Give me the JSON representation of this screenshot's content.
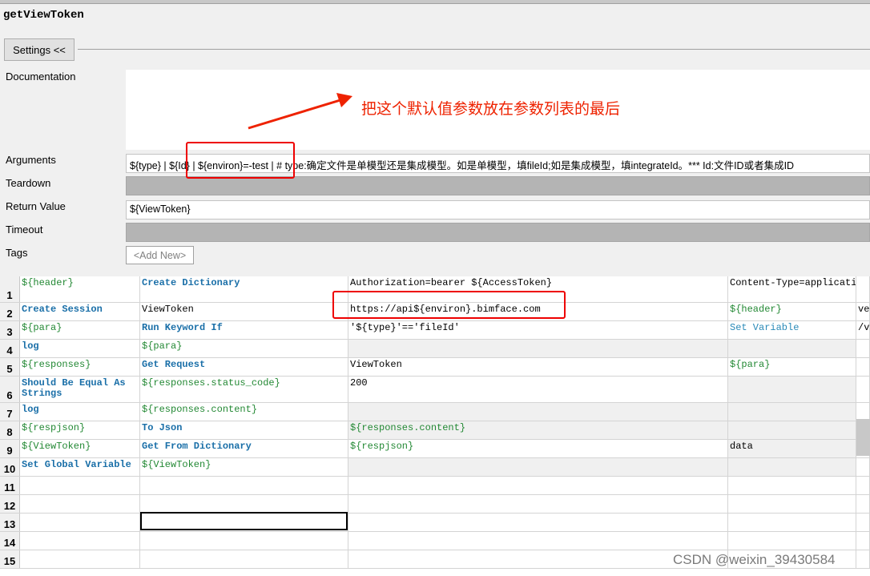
{
  "title": "getViewToken",
  "settings_button": "Settings <<",
  "labels": {
    "documentation": "Documentation",
    "arguments": "Arguments",
    "teardown": "Teardown",
    "return_value": "Return Value",
    "timeout": "Timeout",
    "tags": "Tags"
  },
  "fields": {
    "arguments": "${type} | ${Id} | ${environ}=-test | # type:确定文件是单模型还是集成模型。如是单模型，填fileId;如是集成模型，填integrateId。*** Id:文件ID或者集成ID",
    "teardown": "",
    "return_value": "${ViewToken}",
    "timeout": ""
  },
  "tags_button": "<Add New>",
  "annotation": "把这个默认值参数放在参数列表的最后",
  "grid": {
    "rows": [
      {
        "num": "1",
        "cells": [
          {
            "t": "${header}",
            "s": "var"
          },
          {
            "t": "Create Dictionary",
            "s": "kw"
          },
          {
            "t": "Authorization=bearer ${AccessToken}",
            "s": "plain"
          },
          {
            "t": "Content-Type=applicatio",
            "s": "plain"
          },
          {
            "t": "",
            "s": "plain"
          }
        ]
      },
      {
        "num": "2",
        "cells": [
          {
            "t": "Create Session",
            "s": "kw"
          },
          {
            "t": "ViewToken",
            "s": "plain"
          },
          {
            "t": "https://api${environ}.bimface.com",
            "s": "plain"
          },
          {
            "t": "${header}",
            "s": "var"
          },
          {
            "t": "ve",
            "s": "plain"
          }
        ]
      },
      {
        "num": "3",
        "cells": [
          {
            "t": "${para}",
            "s": "var"
          },
          {
            "t": "Run Keyword If",
            "s": "kw"
          },
          {
            "t": "'${type}'=='fileId'",
            "s": "plain"
          },
          {
            "t": "Set Variable",
            "s": "kwlight"
          },
          {
            "t": "/v",
            "s": "plain"
          }
        ]
      },
      {
        "num": "4",
        "cells": [
          {
            "t": "log",
            "s": "kw"
          },
          {
            "t": "${para}",
            "s": "var"
          },
          {
            "t": "",
            "s": "plain"
          },
          {
            "t": "",
            "s": "plain"
          },
          {
            "t": "",
            "s": "plain"
          }
        ]
      },
      {
        "num": "5",
        "cells": [
          {
            "t": "${responses}",
            "s": "var"
          },
          {
            "t": "Get Request",
            "s": "kw"
          },
          {
            "t": "ViewToken",
            "s": "plain"
          },
          {
            "t": "${para}",
            "s": "var"
          },
          {
            "t": "",
            "s": "plain"
          }
        ]
      },
      {
        "num": "6",
        "cells": [
          {
            "t": "Should Be Equal As Strings",
            "s": "kw"
          },
          {
            "t": "${responses.status_code}",
            "s": "var"
          },
          {
            "t": "200",
            "s": "plain"
          },
          {
            "t": "",
            "s": "plain"
          },
          {
            "t": "",
            "s": "plain"
          }
        ]
      },
      {
        "num": "7",
        "cells": [
          {
            "t": "log",
            "s": "kw"
          },
          {
            "t": "${responses.content}",
            "s": "var"
          },
          {
            "t": "",
            "s": "plain"
          },
          {
            "t": "",
            "s": "plain"
          },
          {
            "t": "",
            "s": "plain"
          }
        ]
      },
      {
        "num": "8",
        "cells": [
          {
            "t": "${respjson}",
            "s": "var"
          },
          {
            "t": "To Json",
            "s": "kw"
          },
          {
            "t": "${responses.content}",
            "s": "var"
          },
          {
            "t": "",
            "s": "plain"
          },
          {
            "t": "",
            "s": "plain"
          }
        ]
      },
      {
        "num": "9",
        "cells": [
          {
            "t": "${ViewToken}",
            "s": "var"
          },
          {
            "t": "Get From Dictionary",
            "s": "kw"
          },
          {
            "t": "${respjson}",
            "s": "var"
          },
          {
            "t": "data",
            "s": "plain"
          },
          {
            "t": "",
            "s": "plain"
          }
        ]
      },
      {
        "num": "10",
        "cells": [
          {
            "t": "Set Global Variable",
            "s": "kw"
          },
          {
            "t": "${ViewToken}",
            "s": "var"
          },
          {
            "t": "",
            "s": "plain"
          },
          {
            "t": "",
            "s": "plain"
          },
          {
            "t": "",
            "s": "plain"
          }
        ]
      },
      {
        "num": "11",
        "cells": [
          {
            "t": "",
            "s": "plain"
          },
          {
            "t": "",
            "s": "plain"
          },
          {
            "t": "",
            "s": "plain"
          },
          {
            "t": "",
            "s": "plain"
          },
          {
            "t": "",
            "s": "plain"
          }
        ]
      },
      {
        "num": "12",
        "cells": [
          {
            "t": "",
            "s": "plain"
          },
          {
            "t": "",
            "s": "plain"
          },
          {
            "t": "",
            "s": "plain"
          },
          {
            "t": "",
            "s": "plain"
          },
          {
            "t": "",
            "s": "plain"
          }
        ]
      },
      {
        "num": "13",
        "cells": [
          {
            "t": "",
            "s": "plain"
          },
          {
            "t": "",
            "s": "plain"
          },
          {
            "t": "",
            "s": "plain"
          },
          {
            "t": "",
            "s": "plain"
          },
          {
            "t": "",
            "s": "plain"
          }
        ]
      },
      {
        "num": "14",
        "cells": [
          {
            "t": "",
            "s": "plain"
          },
          {
            "t": "",
            "s": "plain"
          },
          {
            "t": "",
            "s": "plain"
          },
          {
            "t": "",
            "s": "plain"
          },
          {
            "t": "",
            "s": "plain"
          }
        ]
      },
      {
        "num": "15",
        "cells": [
          {
            "t": "",
            "s": "plain"
          },
          {
            "t": "",
            "s": "plain"
          },
          {
            "t": "",
            "s": "plain"
          },
          {
            "t": "",
            "s": "plain"
          },
          {
            "t": "",
            "s": "plain"
          }
        ]
      }
    ]
  },
  "watermark": "CSDN @weixin_39430584",
  "colors": {
    "keyword": "#1a6fa8",
    "variable": "#228833",
    "annotation": "#ee2200"
  }
}
